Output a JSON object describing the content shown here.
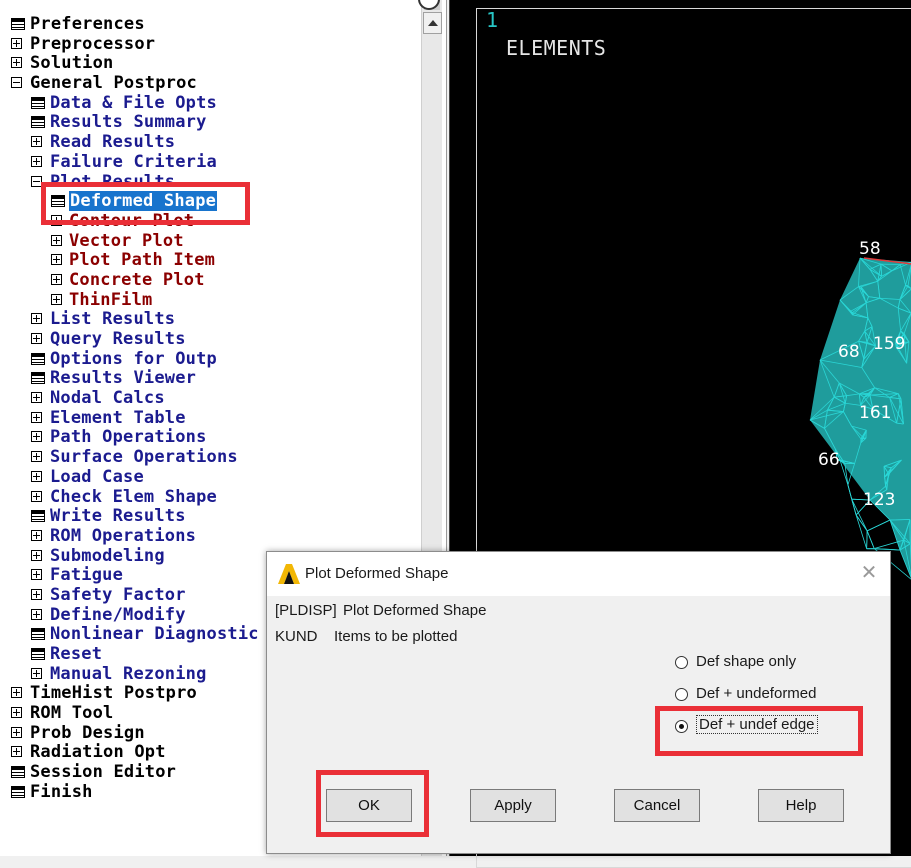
{
  "tree": {
    "items": [
      {
        "label": "Preferences",
        "level": 0,
        "icon": "doc",
        "color": "black"
      },
      {
        "label": "Preprocessor",
        "level": 0,
        "icon": "plus",
        "color": "black"
      },
      {
        "label": "Solution",
        "level": 0,
        "icon": "plus",
        "color": "black"
      },
      {
        "label": "General Postproc",
        "level": 0,
        "icon": "minus",
        "color": "black"
      },
      {
        "label": "Data & File Opts",
        "level": 1,
        "icon": "doc",
        "color": "navy"
      },
      {
        "label": "Results Summary",
        "level": 1,
        "icon": "doc",
        "color": "navy"
      },
      {
        "label": "Read Results",
        "level": 1,
        "icon": "plus",
        "color": "navy"
      },
      {
        "label": "Failure Criteria",
        "level": 1,
        "icon": "plus",
        "color": "navy"
      },
      {
        "label": "Plot Results",
        "level": 1,
        "icon": "minus",
        "color": "navy"
      },
      {
        "label": "Deformed Shape",
        "level": 2,
        "icon": "doc",
        "color": "maroon",
        "selected": true
      },
      {
        "label": "Contour Plot",
        "level": 2,
        "icon": "plus",
        "color": "maroon"
      },
      {
        "label": "Vector Plot",
        "level": 2,
        "icon": "plus",
        "color": "maroon"
      },
      {
        "label": "Plot Path Item",
        "level": 2,
        "icon": "plus",
        "color": "maroon"
      },
      {
        "label": "Concrete Plot",
        "level": 2,
        "icon": "plus",
        "color": "maroon"
      },
      {
        "label": "ThinFilm",
        "level": 2,
        "icon": "plus",
        "color": "maroon"
      },
      {
        "label": "List Results",
        "level": 1,
        "icon": "plus",
        "color": "navy"
      },
      {
        "label": "Query Results",
        "level": 1,
        "icon": "plus",
        "color": "navy"
      },
      {
        "label": "Options for Outp",
        "level": 1,
        "icon": "doc",
        "color": "navy"
      },
      {
        "label": "Results Viewer",
        "level": 1,
        "icon": "doc",
        "color": "navy"
      },
      {
        "label": "Nodal Calcs",
        "level": 1,
        "icon": "plus",
        "color": "navy"
      },
      {
        "label": "Element Table",
        "level": 1,
        "icon": "plus",
        "color": "navy"
      },
      {
        "label": "Path Operations",
        "level": 1,
        "icon": "plus",
        "color": "navy"
      },
      {
        "label": "Surface Operations",
        "level": 1,
        "icon": "plus",
        "color": "navy"
      },
      {
        "label": "Load Case",
        "level": 1,
        "icon": "plus",
        "color": "navy"
      },
      {
        "label": "Check Elem Shape",
        "level": 1,
        "icon": "plus",
        "color": "navy"
      },
      {
        "label": "Write Results",
        "level": 1,
        "icon": "doc",
        "color": "navy"
      },
      {
        "label": "ROM Operations",
        "level": 1,
        "icon": "plus",
        "color": "navy"
      },
      {
        "label": "Submodeling",
        "level": 1,
        "icon": "plus",
        "color": "navy"
      },
      {
        "label": "Fatigue",
        "level": 1,
        "icon": "plus",
        "color": "navy"
      },
      {
        "label": "Safety Factor",
        "level": 1,
        "icon": "plus",
        "color": "navy"
      },
      {
        "label": "Define/Modify",
        "level": 1,
        "icon": "plus",
        "color": "navy"
      },
      {
        "label": "Nonlinear Diagnostic",
        "level": 1,
        "icon": "doc",
        "color": "navy"
      },
      {
        "label": "Reset",
        "level": 1,
        "icon": "doc",
        "color": "navy"
      },
      {
        "label": "Manual Rezoning",
        "level": 1,
        "icon": "plus",
        "color": "navy"
      },
      {
        "label": "TimeHist Postpro",
        "level": 0,
        "icon": "plus",
        "color": "black"
      },
      {
        "label": "ROM Tool",
        "level": 0,
        "icon": "plus",
        "color": "black"
      },
      {
        "label": "Prob Design",
        "level": 0,
        "icon": "plus",
        "color": "black"
      },
      {
        "label": "Radiation Opt",
        "level": 0,
        "icon": "plus",
        "color": "black"
      },
      {
        "label": "Session Editor",
        "level": 0,
        "icon": "doc",
        "color": "black"
      },
      {
        "label": "Finish",
        "level": 0,
        "icon": "doc",
        "color": "black"
      }
    ]
  },
  "graphics": {
    "window_number": "1",
    "title": "ELEMENTS",
    "node_labels": [
      "58",
      "159",
      "161",
      "123"
    ],
    "partial_labels": [
      "68",
      "66"
    ],
    "mesh_color": "#2ad6d6",
    "mesh_fill": "#1f9c9c"
  },
  "dialog": {
    "title": "Plot Deformed Shape",
    "command": "[PLDISP]",
    "command_desc": "Plot Deformed Shape",
    "field": "KUND",
    "field_desc": "Items to be plotted",
    "options": [
      {
        "label": "Def shape only",
        "checked": false
      },
      {
        "label": "Def + undeformed",
        "checked": false
      },
      {
        "label": "Def + undef edge",
        "checked": true
      }
    ],
    "buttons": {
      "ok": "OK",
      "apply": "Apply",
      "cancel": "Cancel",
      "help": "Help"
    }
  },
  "colors": {
    "annotation": "#ea2f37",
    "selection": "#1874cd",
    "navy_text": "#1b1b8f",
    "maroon_text": "#8b0000"
  }
}
